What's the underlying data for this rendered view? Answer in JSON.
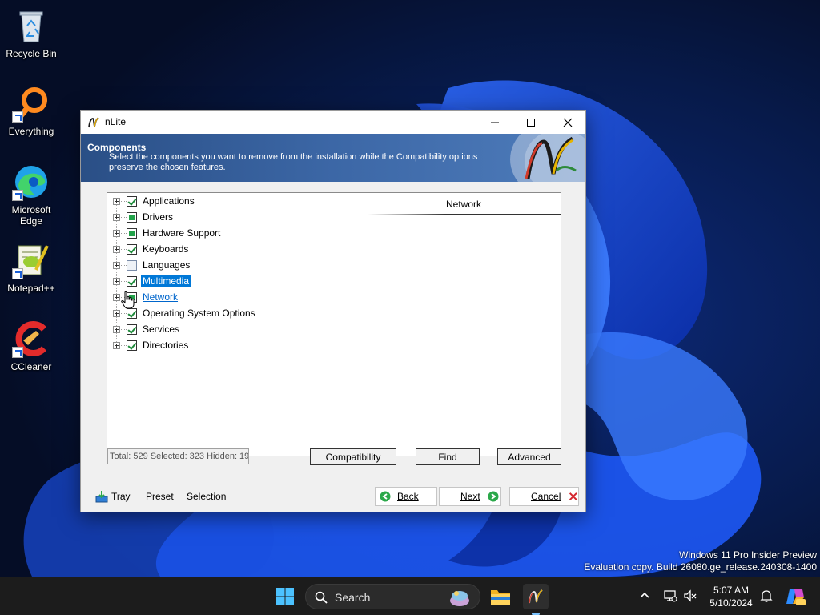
{
  "desktop": {
    "icons": [
      {
        "label": "Recycle Bin",
        "icon": "recycle-bin-icon"
      },
      {
        "label": "Everything",
        "icon": "everything-search-icon"
      },
      {
        "label": "Microsoft Edge",
        "icon": "edge-icon"
      },
      {
        "label": "Notepad++",
        "icon": "notepadpp-icon"
      },
      {
        "label": "CCleaner",
        "icon": "ccleaner-icon"
      }
    ]
  },
  "window": {
    "title": "nLite",
    "header": {
      "title": "Components",
      "description": "Select the components you want to remove from the installation while the Compatibility options preserve the chosen features."
    },
    "tree": [
      {
        "label": "Applications",
        "state": "checked"
      },
      {
        "label": "Drivers",
        "state": "partial"
      },
      {
        "label": "Hardware Support",
        "state": "partial"
      },
      {
        "label": "Keyboards",
        "state": "checked"
      },
      {
        "label": "Languages",
        "state": "unchecked"
      },
      {
        "label": "Multimedia",
        "state": "checked",
        "selected": true
      },
      {
        "label": "Network",
        "state": "partial",
        "hover": true
      },
      {
        "label": "Operating System Options",
        "state": "checked"
      },
      {
        "label": "Services",
        "state": "checked"
      },
      {
        "label": "Directories",
        "state": "checked"
      }
    ],
    "detail_title": "Network",
    "status": "Total: 529 Selected: 323 Hidden: 19",
    "buttons": {
      "compatibility": "Compatibility",
      "find": "Find",
      "advanced": "Advanced"
    },
    "footer": {
      "tray": "Tray",
      "preset": "Preset",
      "selection": "Selection",
      "back": "Back",
      "next": "Next",
      "cancel": "Cancel"
    }
  },
  "watermark": {
    "line1": "Windows 11 Pro Insider Preview",
    "line2": "Evaluation copy. Build 26080.ge_release.240308-1400"
  },
  "taskbar": {
    "search_label": "Search",
    "time": "5:07 AM",
    "date": "5/10/2024",
    "tray_icons": [
      "chevron-up-icon",
      "network-icon",
      "volume-muted-icon",
      "notification-bell-icon",
      "copilot-icon"
    ],
    "pinned": [
      "windows-start-icon",
      "file-explorer-icon",
      "nlite-app-icon"
    ]
  },
  "colors": {
    "selection": "#0078d7",
    "header_bg": "#3c67a6",
    "check_green": "#1d8a3a"
  }
}
